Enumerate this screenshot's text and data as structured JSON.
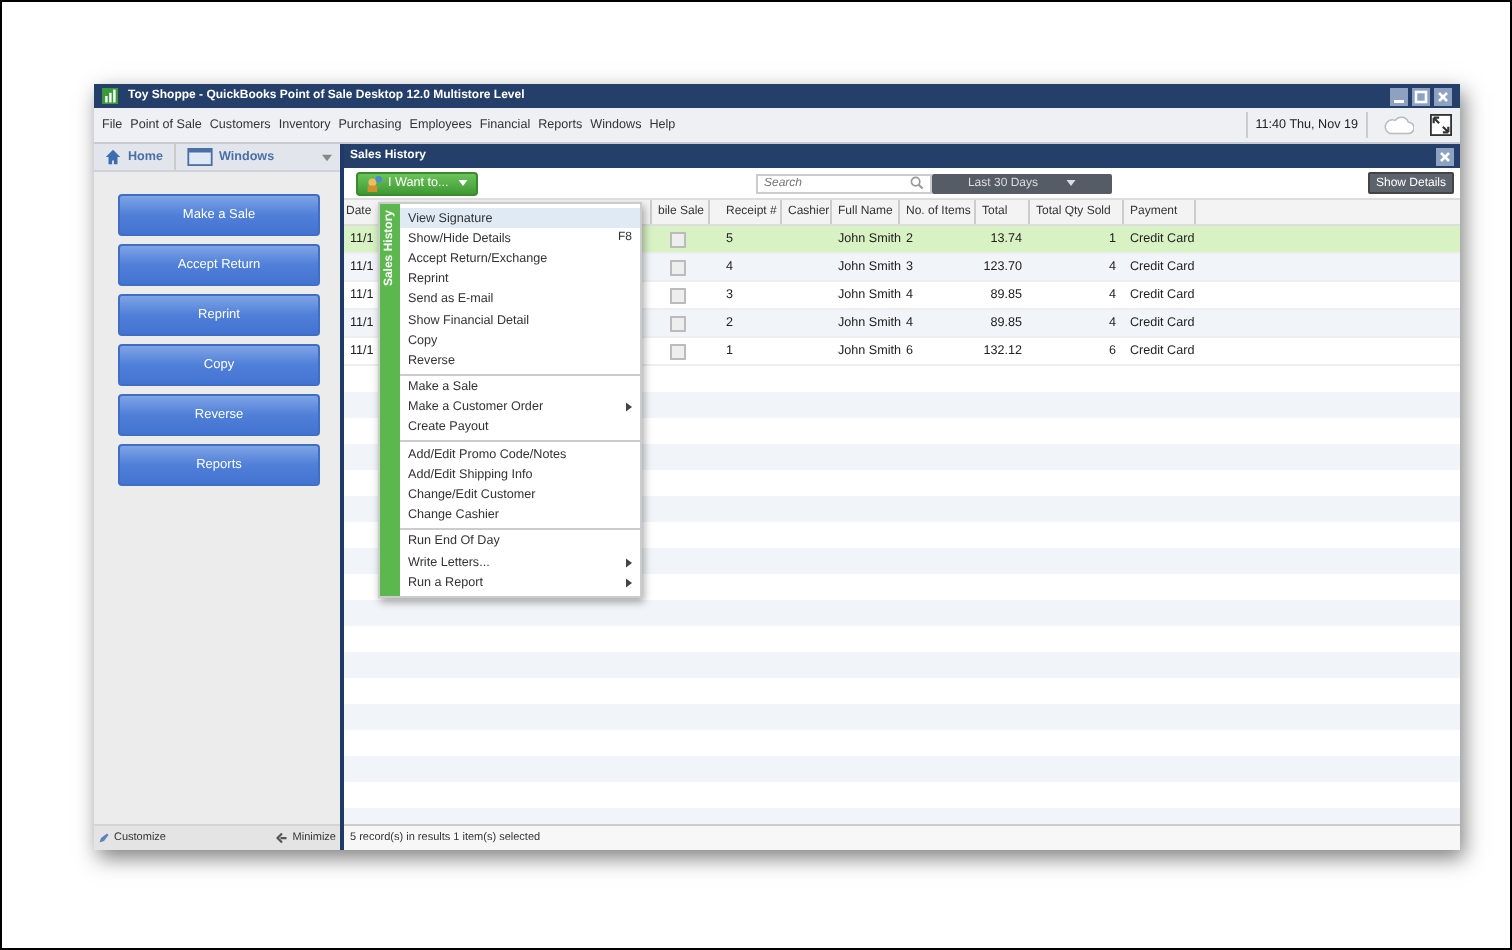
{
  "window": {
    "title": "Toy Shoppe - QuickBooks Point of Sale Desktop 12.0 Multistore Level"
  },
  "menu_bar": {
    "items": [
      "File",
      "Point of Sale",
      "Customers",
      "Inventory",
      "Purchasing",
      "Employees",
      "Financial",
      "Reports",
      "Windows",
      "Help"
    ],
    "clock": "11:40 Thu, Nov 19"
  },
  "nav": {
    "home": "Home",
    "windows": "Windows"
  },
  "sidebar": {
    "buttons": [
      "Make a Sale",
      "Accept Return",
      "Reprint",
      "Copy",
      "Reverse",
      "Reports"
    ],
    "customize": "Customize",
    "minimize": "Minimize"
  },
  "panel": {
    "title": "Sales History",
    "i_want_to": "I Want to...",
    "search": {
      "placeholder": "Search"
    },
    "period": "Last 30 Days",
    "show_details": "Show Details"
  },
  "table": {
    "columns": [
      "Date",
      "bile Sale",
      "Receipt #",
      "Cashier",
      "Full Name",
      "No. of Items",
      "Total",
      "Total Qty Sold",
      "Payment"
    ],
    "rows": [
      {
        "date": "11/1",
        "mobile_sale": false,
        "receipt": "5",
        "full_name": "John Smith",
        "items": "2",
        "total": "13.74",
        "qty": "1",
        "payment": "Credit Card",
        "selected": true
      },
      {
        "date": "11/1",
        "mobile_sale": false,
        "receipt": "4",
        "full_name": "John Smith",
        "items": "3",
        "total": "123.70",
        "qty": "4",
        "payment": "Credit Card",
        "selected": false
      },
      {
        "date": "11/1",
        "mobile_sale": false,
        "receipt": "3",
        "full_name": "John Smith",
        "items": "4",
        "total": "89.85",
        "qty": "4",
        "payment": "Credit Card",
        "selected": false
      },
      {
        "date": "11/1",
        "mobile_sale": false,
        "receipt": "2",
        "full_name": "John Smith",
        "items": "4",
        "total": "89.85",
        "qty": "4",
        "payment": "Credit Card",
        "selected": false
      },
      {
        "date": "11/1",
        "mobile_sale": false,
        "receipt": "1",
        "full_name": "John Smith",
        "items": "6",
        "total": "132.12",
        "qty": "6",
        "payment": "Credit Card",
        "selected": false
      }
    ]
  },
  "context_menu": {
    "tab": "Sales History",
    "groups": [
      [
        {
          "label": "View Signature",
          "submenu": false,
          "selected": true
        },
        {
          "label": "Show/Hide Details",
          "shortcut": "F8",
          "submenu": false,
          "selected": false
        },
        {
          "label": "Accept Return/Exchange",
          "submenu": false,
          "selected": false
        },
        {
          "label": "Reprint",
          "submenu": false,
          "selected": false
        },
        {
          "label": "Send as E-mail",
          "submenu": false,
          "selected": false
        },
        {
          "label": "Show Financial Detail",
          "submenu": false,
          "selected": false
        },
        {
          "label": "Copy",
          "submenu": false,
          "selected": false
        },
        {
          "label": "Reverse",
          "submenu": false,
          "selected": false
        }
      ],
      [
        {
          "label": "Make a Sale",
          "submenu": false,
          "selected": false
        },
        {
          "label": "Make a Customer Order",
          "submenu": true,
          "selected": false
        },
        {
          "label": "Create Payout",
          "submenu": false,
          "selected": false
        }
      ],
      [
        {
          "label": "Add/Edit Promo Code/Notes",
          "submenu": false,
          "selected": false
        },
        {
          "label": "Add/Edit Shipping Info",
          "submenu": false,
          "selected": false
        },
        {
          "label": "Change/Edit Customer",
          "submenu": false,
          "selected": false
        },
        {
          "label": "Change Cashier",
          "submenu": false,
          "selected": false
        }
      ],
      [
        {
          "label": "Run End Of Day",
          "submenu": false,
          "selected": false
        },
        {
          "label": "Write Letters...",
          "submenu": true,
          "selected": false
        },
        {
          "label": "Run a Report",
          "submenu": true,
          "selected": false
        }
      ]
    ]
  },
  "status_bar": "5 record(s) in results  1 item(s) selected"
}
